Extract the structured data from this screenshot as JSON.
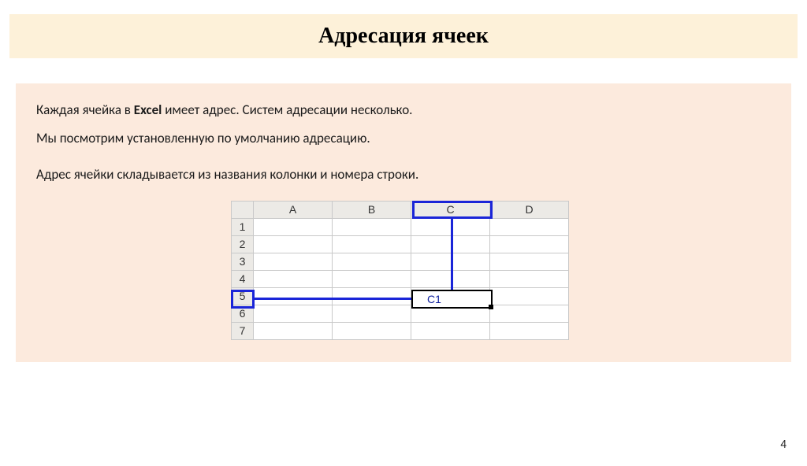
{
  "title": "Адресация ячеек",
  "paragraphs": {
    "p1_pre": "Каждая ячейка в ",
    "p1_bold": "Excel",
    "p1_post": " имеет адрес. Систем адресации несколько.",
    "p2": "Мы посмотрим установленную по умолчанию адресацию.",
    "p3": "Адрес ячейки складывается из названия колонки и номера строки."
  },
  "grid": {
    "columns": [
      "A",
      "B",
      "C",
      "D"
    ],
    "rows": [
      "1",
      "2",
      "3",
      "4",
      "5",
      "6",
      "7"
    ],
    "highlighted_column": "C",
    "highlighted_row": "5",
    "target_cell_value": "C1"
  },
  "page_number": "4"
}
